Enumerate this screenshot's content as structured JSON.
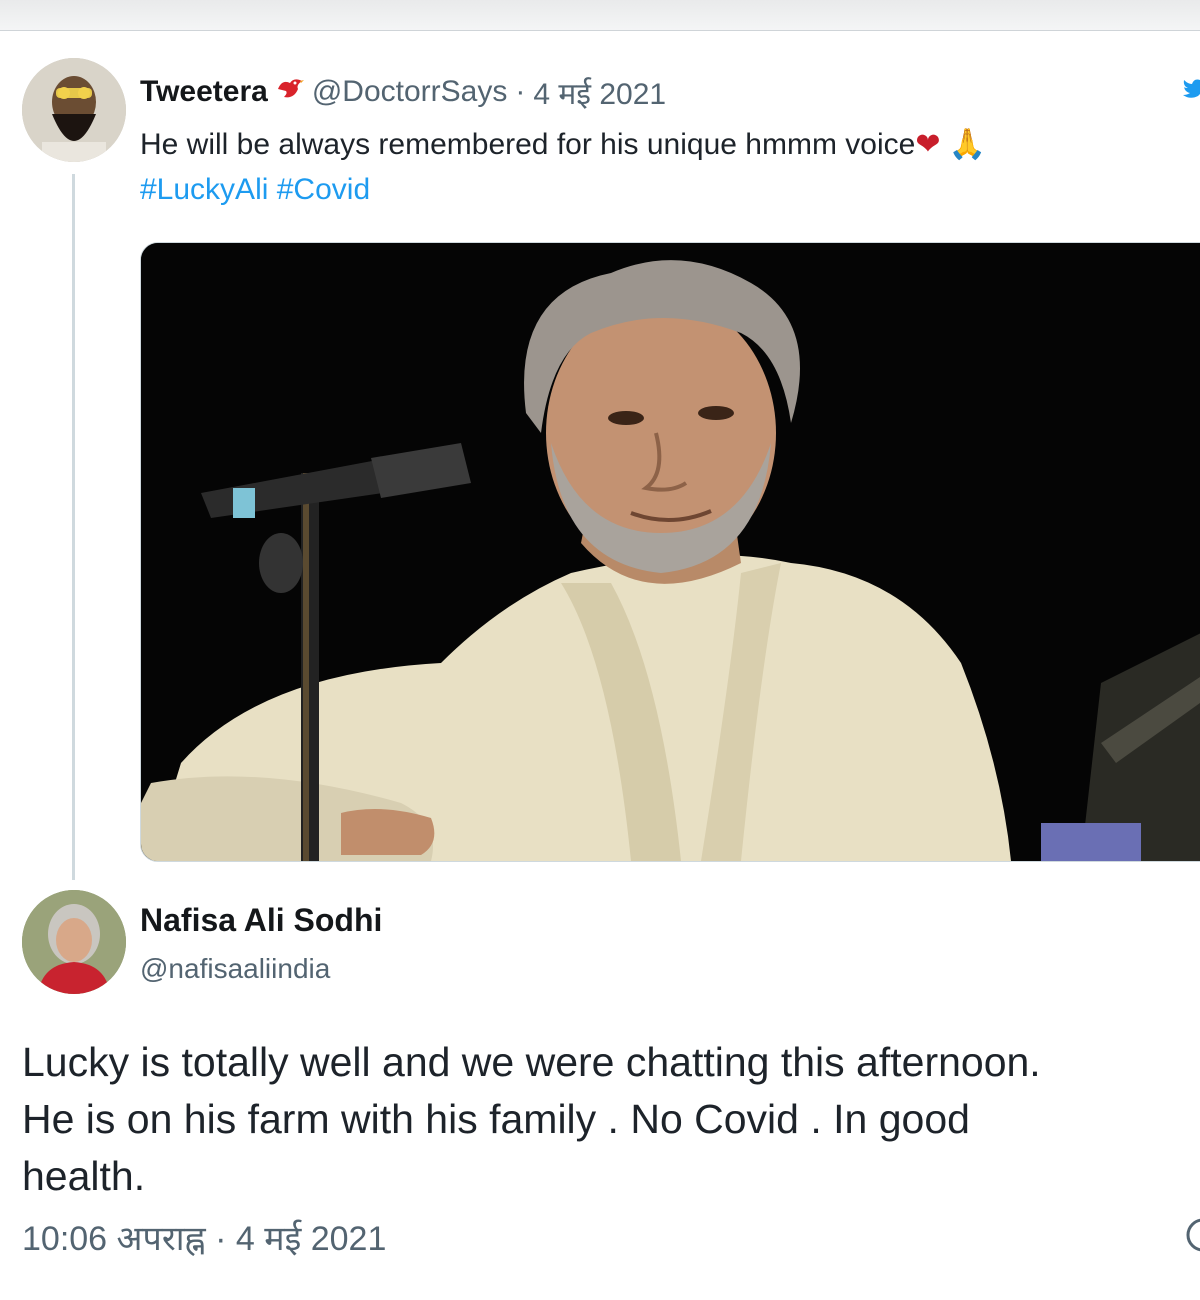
{
  "quoted_tweet": {
    "author_name": "Tweetera",
    "author_handle": "@DoctorrSays",
    "separator": "·",
    "date": "4 मई 2021",
    "text": "He will be always remembered for his unique hmmm voice",
    "emojis": [
      "❤",
      "🙏"
    ],
    "hashtags": [
      "#LuckyAli",
      "#Covid"
    ],
    "media_icon": "photo-of-singer-with-microphone"
  },
  "main_tweet": {
    "author_name": "Nafisa Ali Sodhi",
    "author_handle": "@nafisaaliindia",
    "text_line1": "Lucky is totally well and we were chatting this afternoon.",
    "text_line2": "He is on his farm with his family . No Covid . In good",
    "text_line3": "health.",
    "timestamp": "10:06 अपराह्न · 4 मई 2021"
  },
  "icons": {
    "twitter_logo": "twitter-bird-icon",
    "info": "info-icon",
    "badge": "red-bird-emoji"
  },
  "colors": {
    "link": "#1d9bf0",
    "secondary_text": "#536471",
    "primary_text": "#14171a",
    "thread_line": "#cfd9de"
  }
}
